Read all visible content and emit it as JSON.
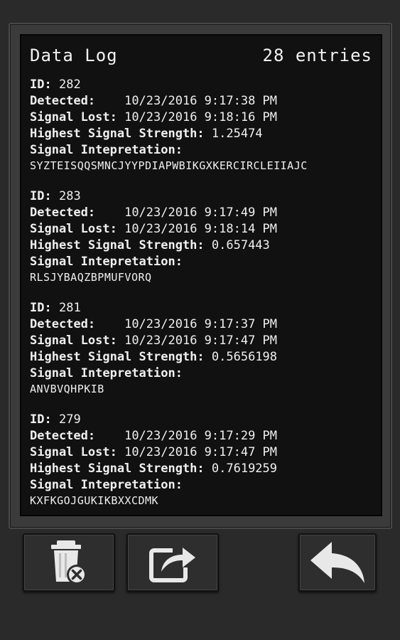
{
  "header": {
    "title": "Data Log",
    "count": "28 entries"
  },
  "labels": {
    "id": "ID:",
    "detected": "Detected:",
    "signal_lost": "Signal Lost:",
    "highest_strength": "Highest Signal Strength:",
    "interpretation": "Signal Intepretation:"
  },
  "entries": [
    {
      "id": "282",
      "detected": "10/23/2016 9:17:38 PM",
      "signal_lost": "10/23/2016 9:18:16 PM",
      "strength": "1.25474",
      "interpretation": "SYZTEISQQSMNCJYYPDIAPWBIKGXKERCIRCLEIIAJC"
    },
    {
      "id": "283",
      "detected": "10/23/2016 9:17:49 PM",
      "signal_lost": "10/23/2016 9:18:14 PM",
      "strength": "0.657443",
      "interpretation": "RLSJYBAQZBPMUFVORQ"
    },
    {
      "id": "281",
      "detected": "10/23/2016 9:17:37 PM",
      "signal_lost": "10/23/2016 9:17:47 PM",
      "strength": "0.5656198",
      "interpretation": "ANVBVQHPKIB"
    },
    {
      "id": "279",
      "detected": "10/23/2016 9:17:29 PM",
      "signal_lost": "10/23/2016 9:17:47 PM",
      "strength": "0.7619259",
      "interpretation": "KXFKGOJGUKIKBXXCDMK"
    }
  ],
  "buttons": {
    "delete_icon": "trash-delete-icon",
    "share_icon": "share-export-icon",
    "back_icon": "back-arrow-icon"
  },
  "colors": {
    "screen_bg": "#111111",
    "text": "#f0f0f0",
    "icon": "#e8e8e8"
  }
}
